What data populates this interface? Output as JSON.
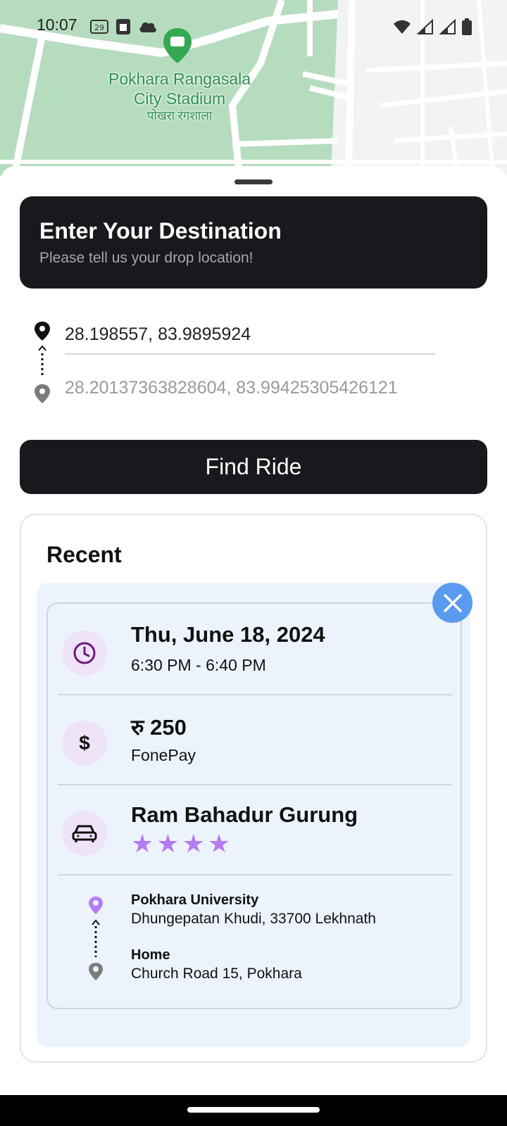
{
  "status_bar": {
    "time": "10:07",
    "icons_left": [
      "calendar-badge-icon",
      "sim-icon",
      "cloud-icon"
    ],
    "icons_right": [
      "wifi-icon",
      "signal-icon",
      "signal-roaming-icon",
      "battery-icon"
    ]
  },
  "map": {
    "poi_name": "Pokhara Rangasala City Stadium",
    "poi_name_local": "पोखरा रंगशाला",
    "colors": {
      "park": "#b6dcbf",
      "road": "#ffffff",
      "land": "#f1f3f4",
      "poi": "#34a853"
    }
  },
  "destination": {
    "title": "Enter Your Destination",
    "subtitle": "Please tell us your drop location!"
  },
  "route": {
    "from_value": "28.198557, 83.9895924",
    "to_placeholder": "28.20137363828604, 83.99425305426121"
  },
  "find_button": {
    "label": "Find Ride"
  },
  "recent": {
    "title": "Recent",
    "ride": {
      "date": "Thu, June 18, 2024",
      "time_range": "6:30 PM - 6:40 PM",
      "fare": "रु 250",
      "payment_method": "FonePay",
      "driver_name": "Ram Bahadur Gurung",
      "rating": 4,
      "pickup_name": "Pokhara University",
      "pickup_address": "Dhungepatan Khudi, 33700 Lekhnath",
      "dropoff_name": "Home",
      "dropoff_address": "Church Road 15, Pokhara"
    }
  },
  "colors": {
    "dark": "#18191d",
    "accent_purple": "#b57cf2",
    "close_blue": "#5a9bef",
    "card_bg": "#edf3fd"
  }
}
